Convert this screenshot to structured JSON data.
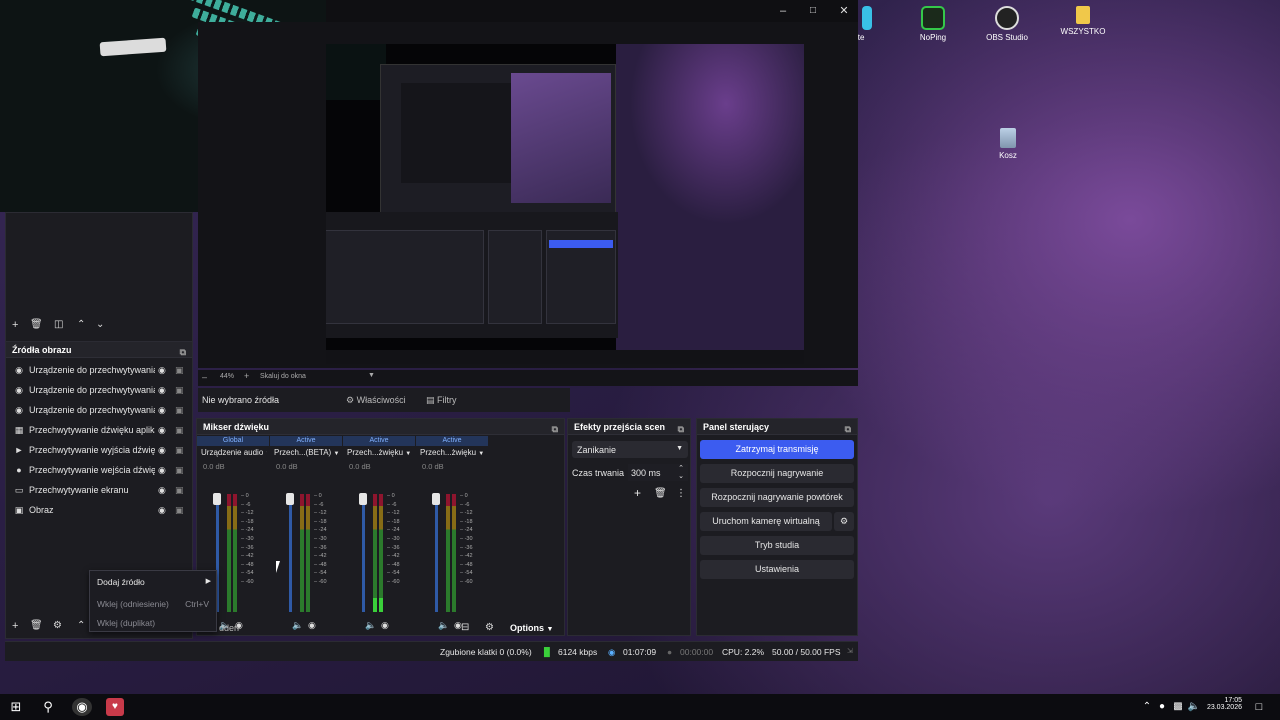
{
  "desktop": {
    "icons": [
      {
        "label": "nite",
        "icon": "app-icon"
      },
      {
        "label": "NoPing",
        "icon": "noping-icon"
      },
      {
        "label": "OBS Studio",
        "icon": "obs-icon"
      },
      {
        "label": "WSZYSTKO",
        "icon": "folder-icon"
      },
      {
        "label": "Kosz",
        "icon": "recycle-bin-icon"
      }
    ]
  },
  "obs": {
    "preview_bar": {
      "zoom": "44%",
      "scale_mode": "Skaluj do okna"
    },
    "source_bar": {
      "no_source": "Nie wybrano źródła",
      "properties": "Właściwości",
      "filters": "Filtry"
    },
    "sources": {
      "title": "Źródła obrazu",
      "items": [
        {
          "label": "Urządzenie do przechwytywania",
          "icon": "camera-icon"
        },
        {
          "label": "Urządzenie do przechwytywania",
          "icon": "camera-icon"
        },
        {
          "label": "Urządzenie do przechwytywania",
          "icon": "camera-icon"
        },
        {
          "label": "Przechwytywanie dźwięku aplikacji",
          "icon": "app-audio-icon"
        },
        {
          "label": "Przechwytywanie wyjścia dźwięku",
          "icon": "speaker-icon"
        },
        {
          "label": "Przechwytywanie wejścia dźwięku",
          "icon": "mic-icon"
        },
        {
          "label": "Przechwytywanie ekranu",
          "icon": "monitor-icon"
        },
        {
          "label": "Obraz",
          "icon": "image-icon"
        }
      ]
    },
    "context_menu": {
      "add_source": "Dodaj źródło",
      "paste_ref": "Wklej (odniesienie)",
      "paste_ref_shortcut": "Ctrl+V",
      "paste_dup": "Wklej (duplikat)"
    },
    "mixer": {
      "title": "Mikser dźwięku",
      "channels": [
        {
          "tag": "Global",
          "name": "Urządzenie audio",
          "db": "0.0 dB",
          "level": 0.0
        },
        {
          "tag": "Active",
          "name": "Przech...(BETA)",
          "db": "0.0 dB",
          "level": 0.0
        },
        {
          "tag": "Active",
          "name": "Przech...żwięku",
          "db": "0.0 dB",
          "level": 0.12
        },
        {
          "tag": "Active",
          "name": "Przech...żwięku",
          "db": "0.0 dB",
          "level": 0.0
        }
      ],
      "scale": [
        "0",
        "-6",
        "-12",
        "-18",
        "-24",
        "-30",
        "-36",
        "-42",
        "-48",
        "-54",
        "-60"
      ],
      "hidden_label": "dden",
      "options": "Options"
    },
    "transitions": {
      "title": "Efekty przejścia scen",
      "selected": "Zanikanie",
      "duration_label": "Czas trwania",
      "duration_value": "300 ms"
    },
    "controls": {
      "title": "Panel sterujący",
      "buttons": [
        "Zatrzymaj transmisję",
        "Rozpocznij nagrywanie",
        "Rozpocznij nagrywanie powtórek",
        "Uruchom kamerę wirtualną",
        "Tryb studia",
        "Ustawienia"
      ]
    },
    "status": {
      "dropped": "Zgubione klatki 0 (0.0%)",
      "bitrate": "6124 kbps",
      "stream_time": "01:07:09",
      "rec_time": "00:00:00",
      "cpu": "CPU: 2.2%",
      "fps": "50.00 / 50.00 FPS"
    }
  },
  "taskbar": {
    "time": "17:05",
    "date": "23.03.2026"
  },
  "colors": {
    "accent": "#3c5cf0",
    "meter_green": "#3ad03a",
    "meter_red": "#a21430"
  }
}
